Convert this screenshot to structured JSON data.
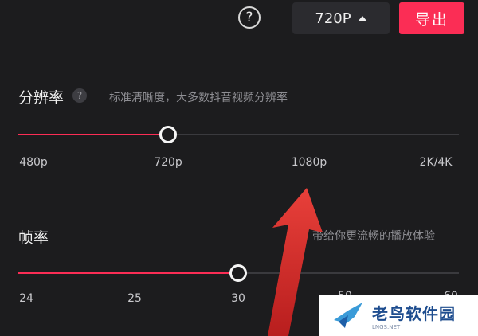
{
  "topbar": {
    "help_symbol": "?",
    "resolution_label": "720P",
    "export_label": "导出"
  },
  "resolution": {
    "title": "分辨率",
    "help_symbol": "?",
    "hint": "标准清晰度，大多数抖音视频分辨率",
    "ticks": [
      "480p",
      "720p",
      "1080p",
      "2K/4K"
    ],
    "selected": "720p"
  },
  "framerate": {
    "title": "帧率",
    "hint": "带给你更流畅的播放体验",
    "ticks": [
      "24",
      "25",
      "30",
      "50",
      "60"
    ],
    "selected": "30"
  },
  "watermark": {
    "name": "老鸟软件园",
    "url": "LNGS.NET"
  },
  "colors": {
    "accent": "#fb2d55",
    "background": "#1c1c1e",
    "arrow": "#e03a3a"
  },
  "icons": {
    "help": "help-circle-icon",
    "dropdown": "caret-up-icon",
    "watermark_logo": "bird-logo-icon"
  }
}
